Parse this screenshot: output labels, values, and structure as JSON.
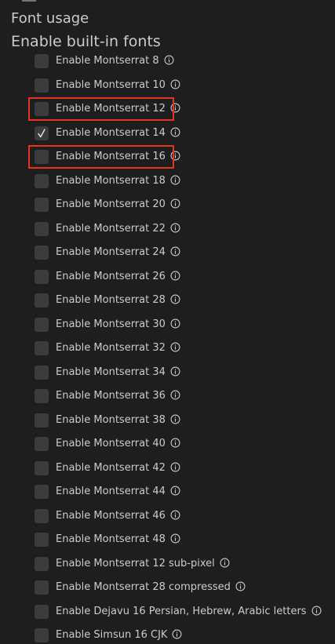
{
  "headings": {
    "font_usage": "Font usage",
    "builtin": "Enable built-in fonts"
  },
  "fonts": [
    {
      "label": "Enable Montserrat 8",
      "checked": false,
      "highlighted": false
    },
    {
      "label": "Enable Montserrat 10",
      "checked": false,
      "highlighted": false
    },
    {
      "label": "Enable Montserrat 12",
      "checked": false,
      "highlighted": true
    },
    {
      "label": "Enable Montserrat 14",
      "checked": true,
      "highlighted": false
    },
    {
      "label": "Enable Montserrat 16",
      "checked": false,
      "highlighted": true
    },
    {
      "label": "Enable Montserrat 18",
      "checked": false,
      "highlighted": false
    },
    {
      "label": "Enable Montserrat 20",
      "checked": false,
      "highlighted": false
    },
    {
      "label": "Enable Montserrat 22",
      "checked": false,
      "highlighted": false
    },
    {
      "label": "Enable Montserrat 24",
      "checked": false,
      "highlighted": false
    },
    {
      "label": "Enable Montserrat 26",
      "checked": false,
      "highlighted": false
    },
    {
      "label": "Enable Montserrat 28",
      "checked": false,
      "highlighted": false
    },
    {
      "label": "Enable Montserrat 30",
      "checked": false,
      "highlighted": false
    },
    {
      "label": "Enable Montserrat 32",
      "checked": false,
      "highlighted": false
    },
    {
      "label": "Enable Montserrat 34",
      "checked": false,
      "highlighted": false
    },
    {
      "label": "Enable Montserrat 36",
      "checked": false,
      "highlighted": false
    },
    {
      "label": "Enable Montserrat 38",
      "checked": false,
      "highlighted": false
    },
    {
      "label": "Enable Montserrat 40",
      "checked": false,
      "highlighted": false
    },
    {
      "label": "Enable Montserrat 42",
      "checked": false,
      "highlighted": false
    },
    {
      "label": "Enable Montserrat 44",
      "checked": false,
      "highlighted": false
    },
    {
      "label": "Enable Montserrat 46",
      "checked": false,
      "highlighted": false
    },
    {
      "label": "Enable Montserrat 48",
      "checked": false,
      "highlighted": false
    },
    {
      "label": "Enable Montserrat 12 sub-pixel",
      "checked": false,
      "highlighted": false
    },
    {
      "label": "Enable Montserrat 28 compressed",
      "checked": false,
      "highlighted": false
    },
    {
      "label": "Enable Dejavu 16 Persian, Hebrew, Arabic letters",
      "checked": false,
      "highlighted": false
    },
    {
      "label": "Enable Simsun 16 CJK",
      "checked": false,
      "highlighted": false
    }
  ],
  "icons": {
    "info": "info-circle-icon",
    "check": "checkmark-icon"
  },
  "colors": {
    "background": "#1e1e1e",
    "checkbox": "#3c3c3c",
    "text": "#cccccc",
    "highlight_border": "#e8321e"
  }
}
